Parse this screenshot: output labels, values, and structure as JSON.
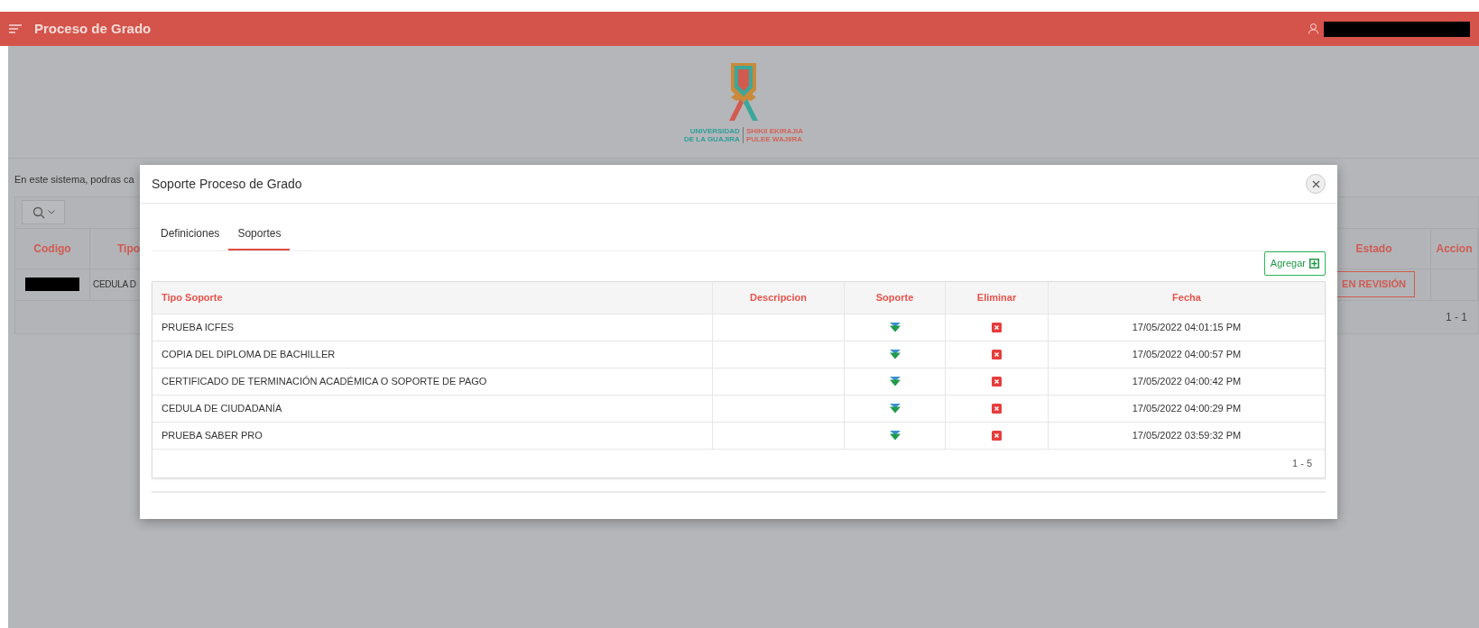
{
  "header": {
    "title": "Proceso de Grado"
  },
  "logo": {
    "left_lines": [
      "UNIVERSIDAD",
      "DE LA GUAJIRA"
    ],
    "right_lines": [
      "SHIKII EKIRAJIA",
      "PULEE WAJIIRA"
    ]
  },
  "intro": "En este sistema, podras ca",
  "background_table": {
    "columns": [
      "Codigo",
      "Tipo",
      "Estado",
      "Accion"
    ],
    "rows": [
      {
        "tipo": "CEDULA D",
        "estado": "EN REVISIÓN"
      }
    ],
    "pagination": "1 - 1"
  },
  "modal": {
    "title": "Soporte Proceso de Grado",
    "tabs": [
      {
        "label": "Definiciones",
        "selected": false
      },
      {
        "label": "Soportes",
        "selected": true
      }
    ],
    "add_button": "Agregar",
    "table": {
      "columns": [
        "Tipo Soporte",
        "Descripcion",
        "Soporte",
        "Eliminar",
        "Fecha"
      ],
      "rows": [
        {
          "tipo_soporte": "PRUEBA ICFES",
          "fecha": "17/05/2022 04:01:15 PM"
        },
        {
          "tipo_soporte": "COPIA DEL DIPLOMA DE BACHILLER",
          "fecha": "17/05/2022 04:00:57 PM"
        },
        {
          "tipo_soporte": "CERTIFICADO DE TERMINACIÓN ACADÉMICA O SOPORTE DE PAGO",
          "fecha": "17/05/2022 04:00:42 PM"
        },
        {
          "tipo_soporte": "CEDULA DE CIUDADANÍA",
          "fecha": "17/05/2022 04:00:29 PM"
        },
        {
          "tipo_soporte": "PRUEBA SABER PRO",
          "fecha": "17/05/2022 03:59:32 PM"
        }
      ]
    },
    "pagination": "1 - 5"
  }
}
